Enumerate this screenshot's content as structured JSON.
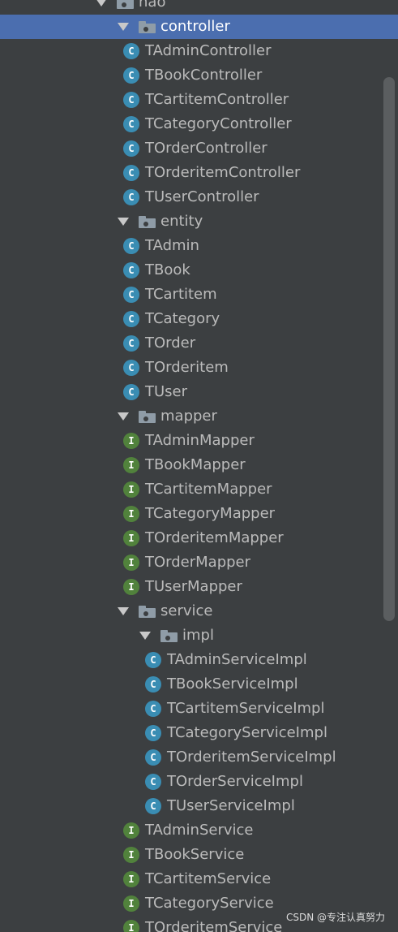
{
  "tree": {
    "nodes": [
      {
        "label": "hao",
        "kind": "package",
        "depth": 0
      },
      {
        "label": "controller",
        "kind": "package",
        "depth": 1,
        "selected": true
      },
      {
        "label": "TAdminController",
        "kind": "class",
        "depth": 2
      },
      {
        "label": "TBookController",
        "kind": "class",
        "depth": 2
      },
      {
        "label": "TCartitemController",
        "kind": "class",
        "depth": 2
      },
      {
        "label": "TCategoryController",
        "kind": "class",
        "depth": 2
      },
      {
        "label": "TOrderController",
        "kind": "class",
        "depth": 2
      },
      {
        "label": "TOrderitemController",
        "kind": "class",
        "depth": 2
      },
      {
        "label": "TUserController",
        "kind": "class",
        "depth": 2
      },
      {
        "label": "entity",
        "kind": "package",
        "depth": 1
      },
      {
        "label": "TAdmin",
        "kind": "class",
        "depth": 2
      },
      {
        "label": "TBook",
        "kind": "class",
        "depth": 2
      },
      {
        "label": "TCartitem",
        "kind": "class",
        "depth": 2
      },
      {
        "label": "TCategory",
        "kind": "class",
        "depth": 2
      },
      {
        "label": "TOrder",
        "kind": "class",
        "depth": 2
      },
      {
        "label": "TOrderitem",
        "kind": "class",
        "depth": 2
      },
      {
        "label": "TUser",
        "kind": "class",
        "depth": 2
      },
      {
        "label": "mapper",
        "kind": "package",
        "depth": 1
      },
      {
        "label": "TAdminMapper",
        "kind": "interface",
        "depth": 2
      },
      {
        "label": "TBookMapper",
        "kind": "interface",
        "depth": 2
      },
      {
        "label": "TCartitemMapper",
        "kind": "interface",
        "depth": 2
      },
      {
        "label": "TCategoryMapper",
        "kind": "interface",
        "depth": 2
      },
      {
        "label": "TOrderitemMapper",
        "kind": "interface",
        "depth": 2
      },
      {
        "label": "TOrderMapper",
        "kind": "interface",
        "depth": 2
      },
      {
        "label": "TUserMapper",
        "kind": "interface",
        "depth": 2
      },
      {
        "label": "service",
        "kind": "package",
        "depth": 1
      },
      {
        "label": "impl",
        "kind": "package",
        "depth": 2
      },
      {
        "label": "TAdminServiceImpl",
        "kind": "class",
        "depth": 3
      },
      {
        "label": "TBookServiceImpl",
        "kind": "class",
        "depth": 3
      },
      {
        "label": "TCartitemServiceImpl",
        "kind": "class",
        "depth": 3
      },
      {
        "label": "TCategoryServiceImpl",
        "kind": "class",
        "depth": 3
      },
      {
        "label": "TOrderitemServiceImpl",
        "kind": "class",
        "depth": 3
      },
      {
        "label": "TOrderServiceImpl",
        "kind": "class",
        "depth": 3
      },
      {
        "label": "TUserServiceImpl",
        "kind": "class",
        "depth": 3
      },
      {
        "label": "TAdminService",
        "kind": "interface",
        "depth": 2
      },
      {
        "label": "TBookService",
        "kind": "interface",
        "depth": 2
      },
      {
        "label": "TCartitemService",
        "kind": "interface",
        "depth": 2
      },
      {
        "label": "TCategoryService",
        "kind": "interface",
        "depth": 2
      },
      {
        "label": "TOrderitemService",
        "kind": "interface",
        "depth": 2
      }
    ]
  },
  "icons": {
    "class_letter": "C",
    "interface_letter": "I"
  },
  "colors": {
    "background": "#3c3f41",
    "selection": "#4b6eaf",
    "text": "#bbbbbb",
    "class_badge": "#3a8db3",
    "interface_badge": "#51823c",
    "folder": "#8f9ca7"
  },
  "watermark": {
    "text": "CSDN @专注认真努力"
  }
}
